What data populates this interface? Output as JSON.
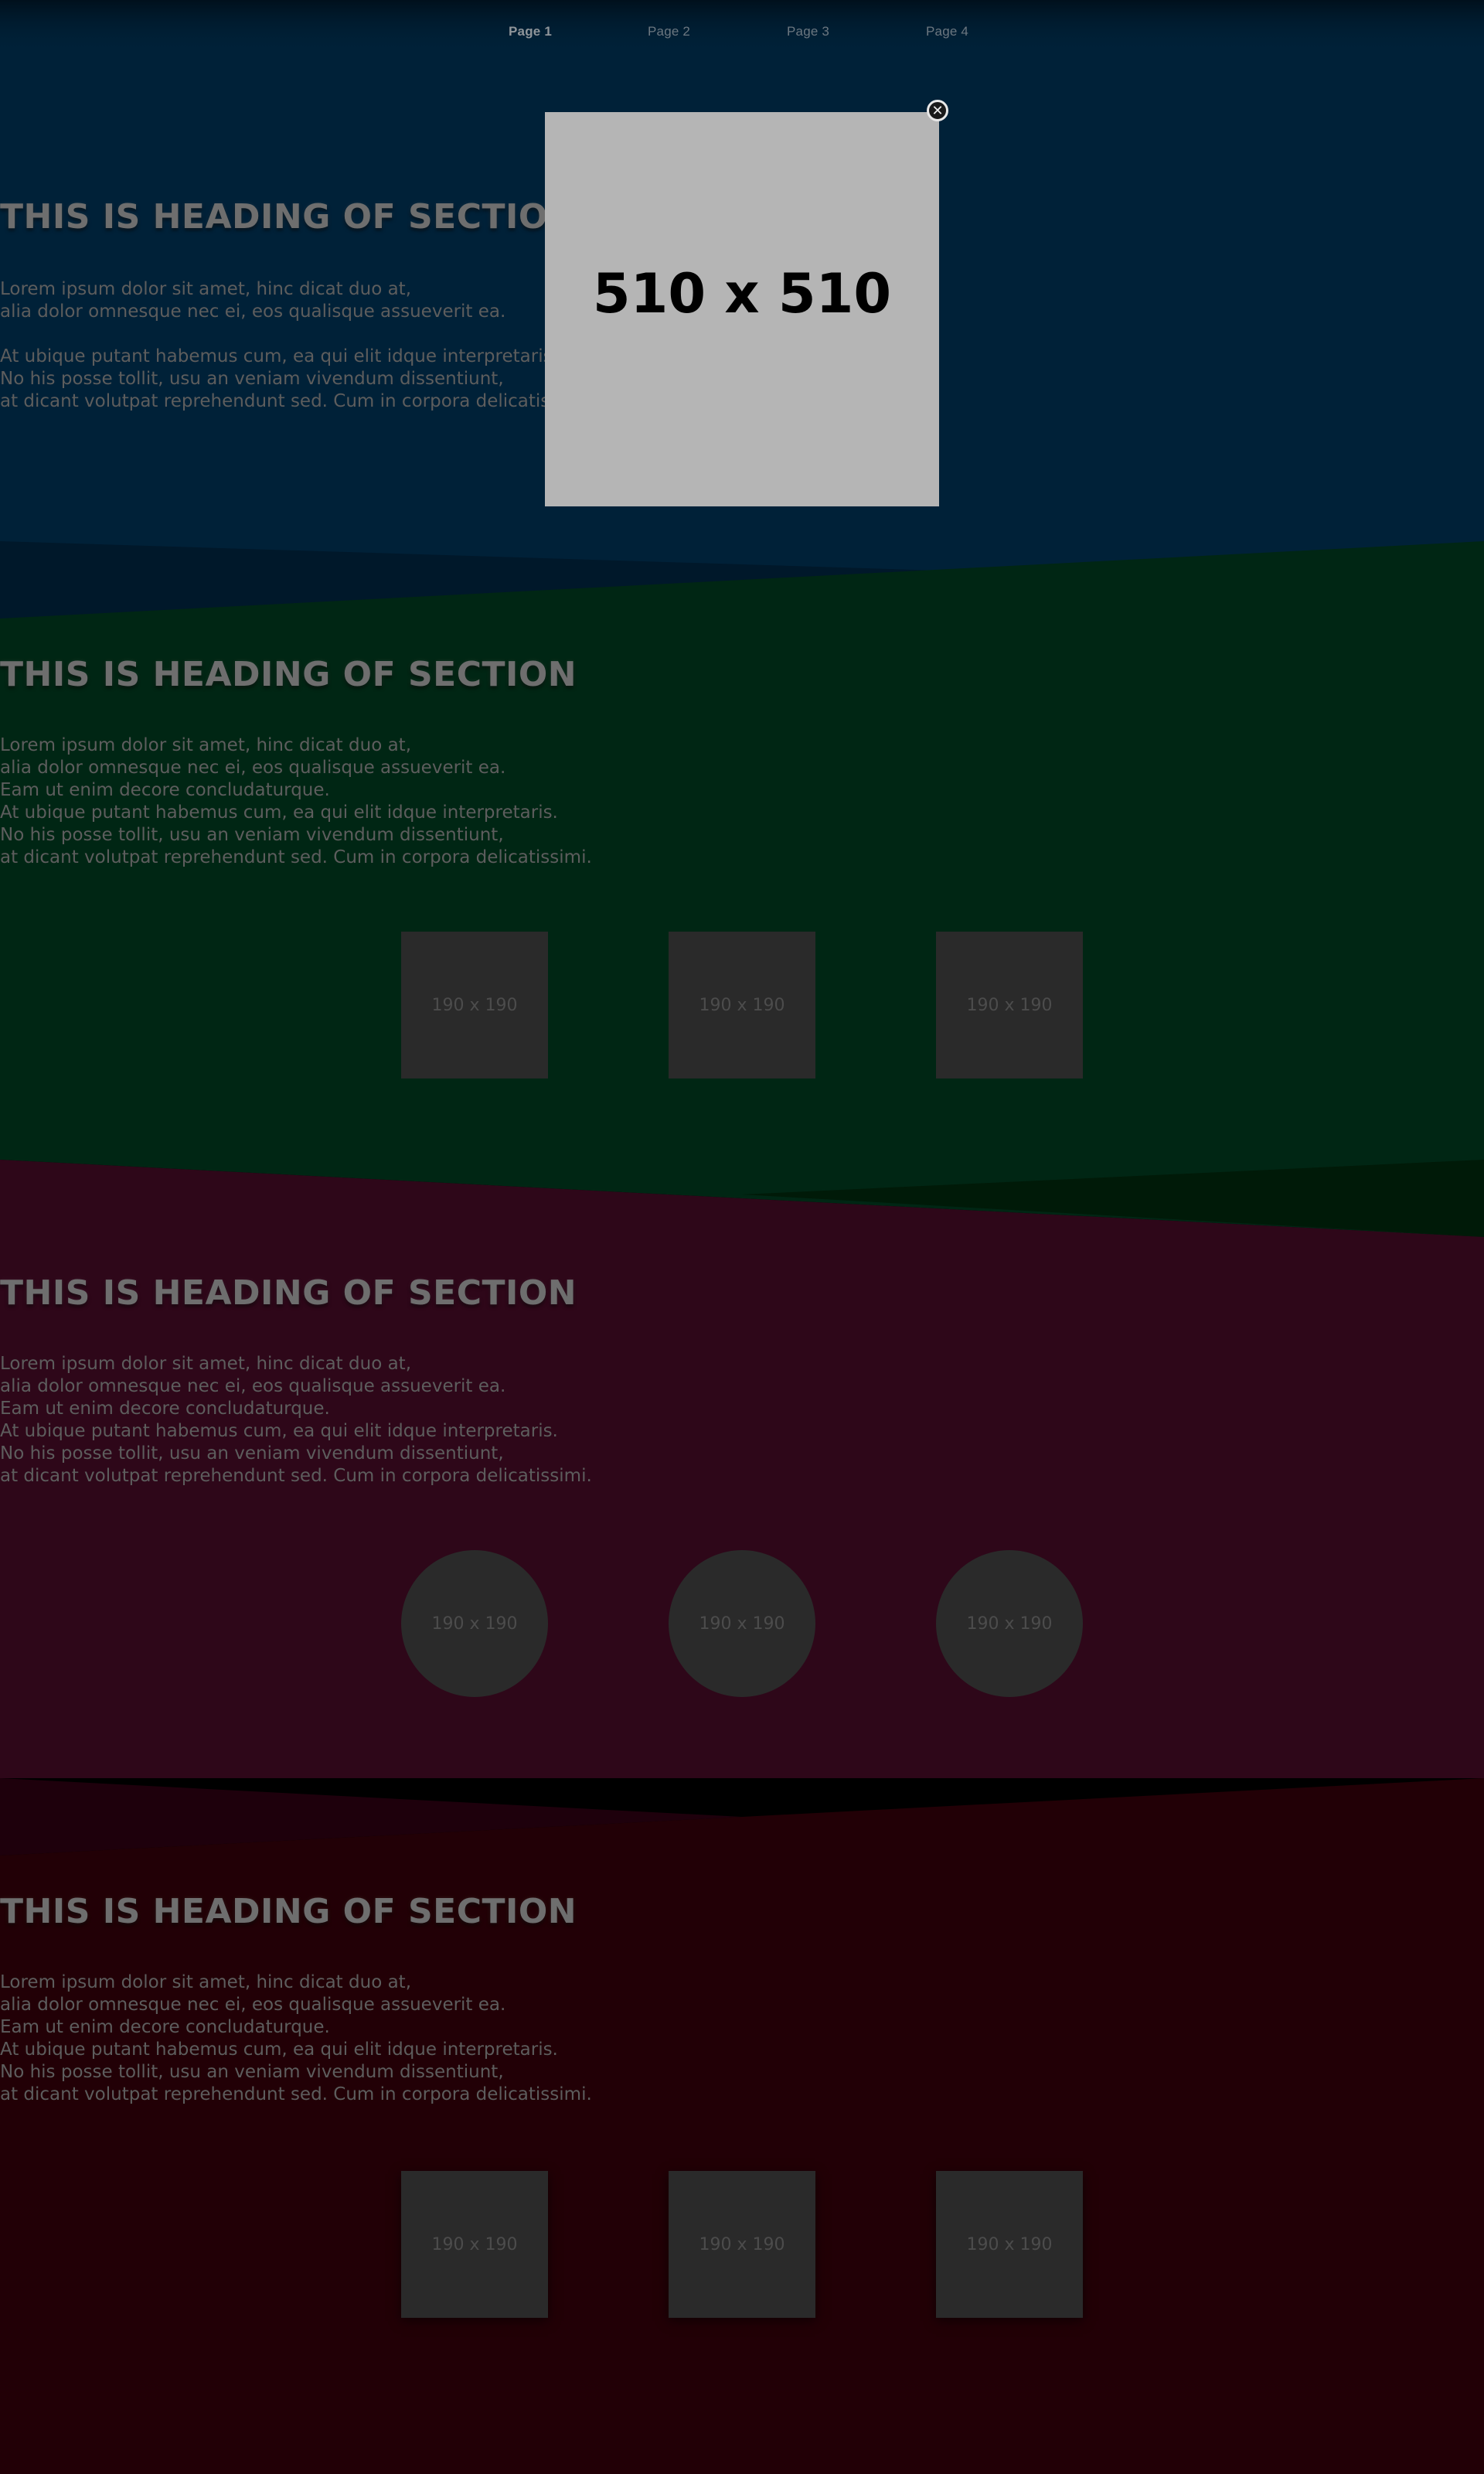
{
  "nav": {
    "links": [
      {
        "label": "Page 1",
        "active": true
      },
      {
        "label": "Page 2",
        "active": false
      },
      {
        "label": "Page 3",
        "active": false
      },
      {
        "label": "Page 4",
        "active": false
      }
    ]
  },
  "modal": {
    "image_label": "510 x 510",
    "close_glyph": "✕"
  },
  "sections": [
    {
      "heading": "THIS IS HEADING OF SECTION",
      "lines": [
        "Lorem ipsum dolor sit amet, hinc dicat duo at,",
        "alia dolor omnesque nec ei, eos qualisque assueverit ea.",
        "",
        "At ubique putant habemus cum, ea qui elit idque interpretaris.",
        "No his posse tollit, usu an veniam vivendum dissentiunt,",
        "at dicant volutpat reprehendunt sed. Cum in corpora delicatissimi."
      ],
      "bg": "#002138"
    },
    {
      "heading": "THIS IS HEADING OF SECTION",
      "lines": [
        "Lorem ipsum dolor sit amet, hinc dicat duo at,",
        "alia dolor omnesque nec ei, eos qualisque assueverit ea.",
        "Eam ut enim decore concludaturque.",
        "At ubique putant habemus cum, ea qui elit idque interpretaris.",
        "No his posse tollit, usu an veniam vivendum dissentiunt,",
        "at dicant volutpat reprehendunt sed. Cum in corpora delicatissimi."
      ],
      "thumbs": [
        "190 x 190",
        "190 x 190",
        "190 x 190"
      ],
      "bg": "#002614"
    },
    {
      "heading": "THIS IS HEADING OF SECTION",
      "lines": [
        "Lorem ipsum dolor sit amet, hinc dicat duo at,",
        "alia dolor omnesque nec ei, eos qualisque assueverit ea.",
        "Eam ut enim decore concludaturque.",
        "At ubique putant habemus cum, ea qui elit idque interpretaris.",
        "No his posse tollit, usu an veniam vivendum dissentiunt,",
        "at dicant volutpat reprehendunt sed. Cum in corpora delicatissimi."
      ],
      "thumbs": [
        "190 x 190",
        "190 x 190",
        "190 x 190"
      ],
      "bg": "#2e0719"
    },
    {
      "heading": "THIS IS HEADING OF SECTION",
      "lines": [
        "Lorem ipsum dolor sit amet, hinc dicat duo at,",
        "alia dolor omnesque nec ei, eos qualisque assueverit ea.",
        "Eam ut enim decore concludaturque.",
        "At ubique putant habemus cum, ea qui elit idque interpretaris.",
        "No his posse tollit, usu an veniam vivendum dissentiunt,",
        "at dicant volutpat reprehendunt sed. Cum in corpora delicatissimi."
      ],
      "thumbs": [
        "190 x 190",
        "190 x 190",
        "190 x 190"
      ],
      "bg": "#220006"
    }
  ]
}
